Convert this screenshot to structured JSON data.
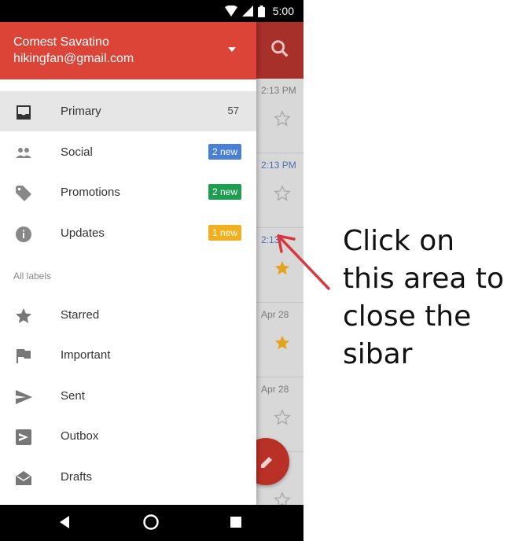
{
  "status_bar": {
    "time": "5:00"
  },
  "drawer": {
    "account_name": "Comest Savatino",
    "account_email": "hikingfan@gmail.com",
    "items": [
      {
        "label": "Primary",
        "count": "57",
        "icon": "inbox-icon"
      },
      {
        "label": "Social",
        "badge": "2 new",
        "badge_color": "#4a7fd6",
        "icon": "people-icon"
      },
      {
        "label": "Promotions",
        "badge": "2 new",
        "badge_color": "#1e9e50",
        "icon": "tag-icon"
      },
      {
        "label": "Updates",
        "badge": "1 new",
        "badge_color": "#f2b01e",
        "icon": "info-icon"
      }
    ],
    "section_label": "All labels",
    "labels": [
      {
        "label": "Starred",
        "icon": "star-icon"
      },
      {
        "label": "Important",
        "icon": "important-flag-icon"
      },
      {
        "label": "Sent",
        "icon": "send-icon"
      },
      {
        "label": "Outbox",
        "icon": "outbox-icon"
      },
      {
        "label": "Drafts",
        "icon": "drafts-icon"
      }
    ]
  },
  "inbox_rows": [
    {
      "time": "2:13 PM",
      "starred": false
    },
    {
      "time": "2:13 PM",
      "starred": false
    },
    {
      "time": "2:13",
      "starred": true
    },
    {
      "time": "Apr 28",
      "starred": true
    },
    {
      "time": "Apr 28",
      "starred": false
    }
  ],
  "annotation": "Click on this area to close the sibar",
  "colors": {
    "header_red": "#db4437",
    "star_gold": "#e3a41b",
    "arrow_red": "#d9373e"
  }
}
